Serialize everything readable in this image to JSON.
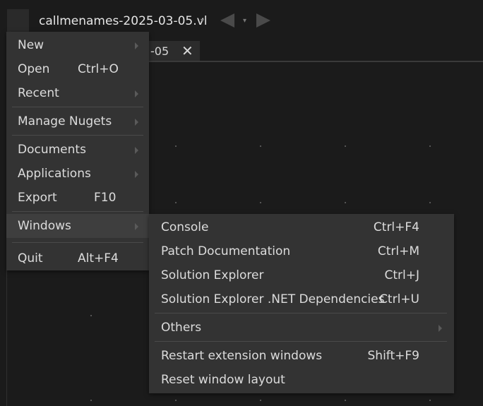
{
  "window": {
    "document_title": "callmenames-2025-03-05.vl",
    "title_dropdown_icon": "caret-down-icon",
    "nav_back_icon": "triangle-left-icon",
    "nav_history_icon": "caret-down-icon",
    "nav_forward_icon": "triangle-right-icon"
  },
  "tab": {
    "label": "-05",
    "close_glyph": "✕"
  },
  "main_menu": {
    "items": [
      {
        "label": "New",
        "shortcut": "",
        "submenu": true
      },
      {
        "label": "Open",
        "shortcut": "Ctrl+O",
        "submenu": false
      },
      {
        "label": "Recent",
        "shortcut": "",
        "submenu": true
      },
      {
        "label": "Manage Nugets",
        "shortcut": "",
        "submenu": true
      },
      {
        "label": "Documents",
        "shortcut": "",
        "submenu": true
      },
      {
        "label": "Applications",
        "shortcut": "",
        "submenu": true
      },
      {
        "label": "Export",
        "shortcut": "F10",
        "submenu": false
      },
      {
        "label": "Windows",
        "shortcut": "",
        "submenu": true,
        "active": true
      },
      {
        "label": "Quit",
        "shortcut": "Alt+F4",
        "submenu": false
      }
    ]
  },
  "windows_submenu": {
    "items": [
      {
        "label": "Console",
        "shortcut": "Ctrl+F4"
      },
      {
        "label": "Patch Documentation",
        "shortcut": "Ctrl+M"
      },
      {
        "label": "Solution Explorer",
        "shortcut": "Ctrl+J"
      },
      {
        "label": "Solution Explorer .NET Dependencies",
        "shortcut": "Ctrl+U"
      },
      {
        "label": "Others",
        "shortcut": "",
        "submenu": true
      },
      {
        "label": "Restart extension windows",
        "shortcut": "Shift+F9"
      },
      {
        "label": "Reset window layout",
        "shortcut": ""
      }
    ]
  },
  "colors": {
    "background": "#1b1b1b",
    "menu_background": "#333333",
    "menu_active": "#3e3e3e",
    "text": "#dcdcdc"
  }
}
